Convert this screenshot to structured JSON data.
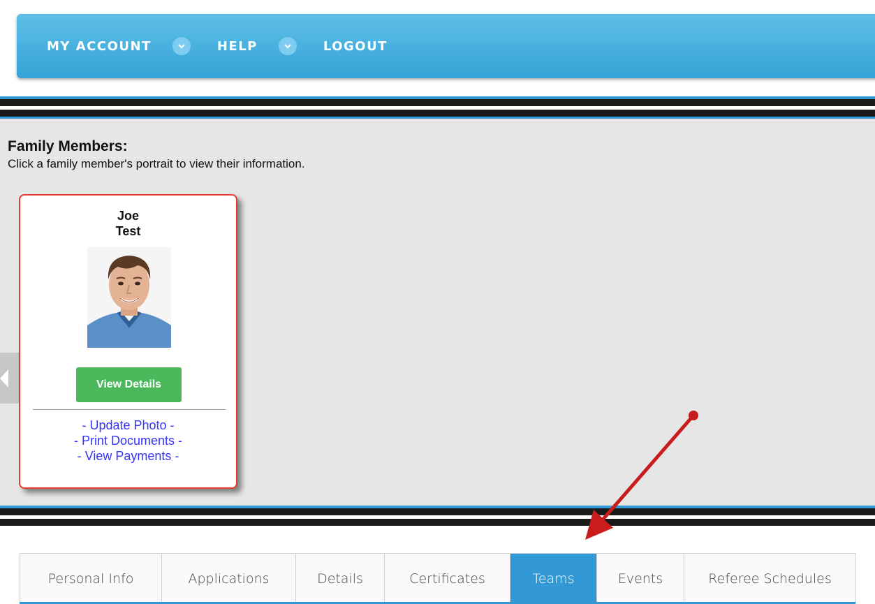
{
  "nav": {
    "items": [
      {
        "label": "MY ACCOUNT",
        "has_dropdown": true
      },
      {
        "label": "HELP",
        "has_dropdown": true
      },
      {
        "label": "LOGOUT",
        "has_dropdown": false
      }
    ]
  },
  "family": {
    "title": "Family Members:",
    "hint": "Click a family member's portrait to view their information.",
    "member": {
      "first_name": "Joe",
      "last_name": "Test",
      "view_details_label": "View Details",
      "links": [
        "- Update Photo -",
        "- Print Documents -",
        "- View Payments -"
      ]
    }
  },
  "tabs": {
    "items": [
      "Personal Info",
      "Applications",
      "Details",
      "Certificates",
      "Teams",
      "Events",
      "Referee Schedules"
    ],
    "active": "Teams"
  },
  "colors": {
    "nav_blue": "#34a3d6",
    "accent_blue": "#3399d6",
    "button_green": "#4cb85c",
    "card_border_red": "#e83a2b",
    "link_blue": "#3333ff",
    "arrow_red": "#c91c1c"
  }
}
